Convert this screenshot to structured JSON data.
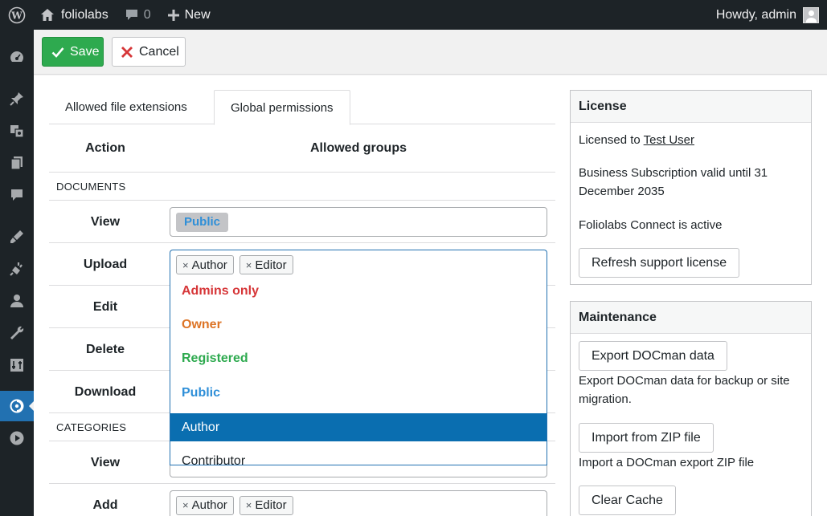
{
  "adminbar": {
    "site_name": "foliolabs",
    "comments_count": "0",
    "new_label": "New",
    "howdy": "Howdy, admin"
  },
  "toolbar": {
    "save_label": "Save",
    "cancel_label": "Cancel"
  },
  "tabs": [
    {
      "label": "Allowed file extensions",
      "active": false
    },
    {
      "label": "Global permissions",
      "active": true
    }
  ],
  "table": {
    "col_action": "Action",
    "col_groups": "Allowed groups",
    "sections": [
      {
        "title": "DOCUMENTS",
        "rows": [
          {
            "label": "View",
            "groups": [
              "Public"
            ]
          },
          {
            "label": "Upload",
            "groups": [
              "Author",
              "Editor"
            ]
          },
          {
            "label": "Edit",
            "groups": []
          },
          {
            "label": "Delete",
            "groups": []
          },
          {
            "label": "Download",
            "groups": []
          }
        ]
      },
      {
        "title": "CATEGORIES",
        "rows": [
          {
            "label": "View",
            "groups": []
          },
          {
            "label": "Add",
            "groups": [
              "Author",
              "Editor"
            ]
          }
        ]
      }
    ],
    "remove_glyph": "×"
  },
  "dropdown": {
    "options": [
      {
        "label": "Admins only",
        "color": "#d63638"
      },
      {
        "label": "Owner",
        "color": "#dd7426"
      },
      {
        "label": "Registered",
        "color": "#2eaa4f"
      },
      {
        "label": "Public",
        "color": "#2f8fd8"
      },
      {
        "label": "Author",
        "highlighted": true
      },
      {
        "label": "Contributor"
      }
    ]
  },
  "license": {
    "title": "License",
    "licensed_to_prefix": "Licensed to",
    "licensed_to_user": "Test User",
    "subscription": "Business Subscription valid until 31 December 2035",
    "connect_status": "Foliolabs Connect is active",
    "refresh_button": "Refresh support license"
  },
  "maintenance": {
    "title": "Maintenance",
    "export_button": "Export DOCman data",
    "export_desc": "Export DOCman data for backup or site migration.",
    "import_button": "Import from ZIP file",
    "import_desc": "Import a DOCman export ZIP file",
    "clear_cache_button": "Clear Cache"
  },
  "colors": {
    "save_green": "#2eaa4f",
    "adminbar_bg": "#1d2327",
    "active_menu": "#2271b1",
    "highlight": "#0a6eb0"
  },
  "icons": {
    "sidemenu": [
      "dashboard-icon",
      "pin-icon",
      "media-icon",
      "pages-icon",
      "comments-icon",
      "appearance-icon",
      "plugins-icon",
      "users-icon",
      "tools-icon",
      "settings-icon",
      "docman-icon",
      "play-icon"
    ]
  }
}
